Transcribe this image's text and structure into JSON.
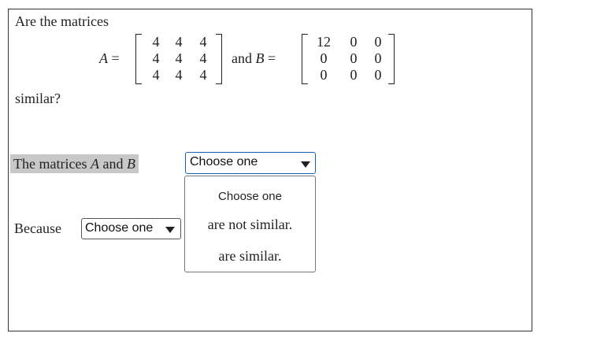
{
  "question": {
    "intro": "Are the matrices",
    "matrix_a_label": "A",
    "equals": "=",
    "connector": "and",
    "matrix_b_label": "B",
    "matrix_a": [
      [
        "4",
        "4",
        "4"
      ],
      [
        "4",
        "4",
        "4"
      ],
      [
        "4",
        "4",
        "4"
      ]
    ],
    "matrix_b": [
      [
        "12",
        "0",
        "0"
      ],
      [
        "0",
        "0",
        "0"
      ],
      [
        "0",
        "0",
        "0"
      ]
    ],
    "outro": "similar?"
  },
  "answer1": {
    "prefix_text": "The matrices",
    "a": "A",
    "and": "and",
    "b": "B",
    "select_value": "Choose one",
    "options": [
      "Choose one",
      "are not similar.",
      "are similar."
    ]
  },
  "answer2": {
    "prefix_text": "Because",
    "select_value": "Choose one"
  }
}
